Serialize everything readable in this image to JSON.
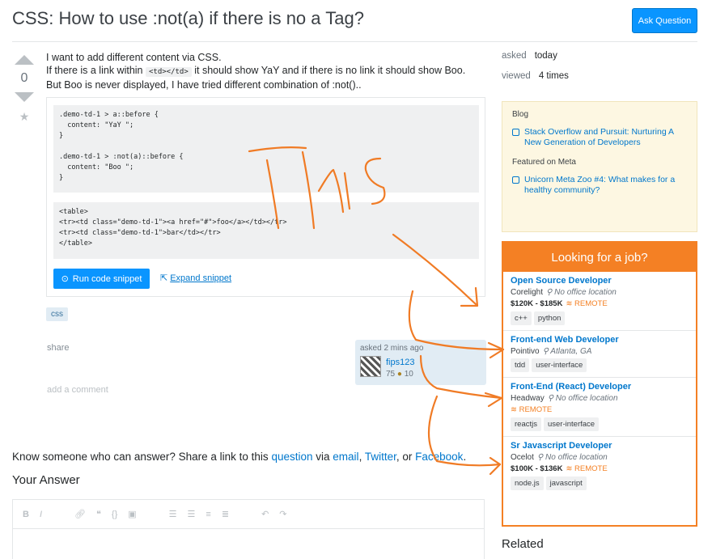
{
  "header": {
    "title": "CSS: How to use :not(a) if there is no a Tag?",
    "ask_button": "Ask Question"
  },
  "vote": {
    "count": "0"
  },
  "question": {
    "line1": "I want to add different content via CSS.",
    "line2_pre": "If there is a link within",
    "inline_code": "<td></td>",
    "line2_post": "it should show YaY and if there is no link it should show Boo. But Boo is never displayed, I have tried different combination of :not()..",
    "code_css": [
      ".demo-td-1 > a::before {",
      "  content: \"YaY \";",
      "}",
      "",
      ".demo-td-1 > :not(a)::before {",
      "  content: \"Boo \";",
      "}"
    ],
    "code_html": [
      "<table>",
      "<tr><td class=\"demo-td-1\"><a href=\"#\">foo</a></td></tr>",
      "<tr><td class=\"demo-td-1\">bar</td></tr>",
      "</table>"
    ],
    "run_button": "Run code snippet",
    "expand_link": "Expand snippet",
    "tag": "css",
    "share": "share",
    "asked_label": "asked 2 mins ago",
    "user_name": "fips123",
    "user_rep": "75",
    "user_bronze": "10",
    "add_comment": "add a comment"
  },
  "know": {
    "pre": "Know someone who can answer? Share a link to this",
    "question_link": "question",
    "via": "via",
    "email": "email",
    "twitter": "Twitter",
    "or": "or",
    "facebook": "Facebook"
  },
  "your_answer": "Your Answer",
  "meta": {
    "asked_label": "asked",
    "asked_value": "today",
    "viewed_label": "viewed",
    "viewed_value": "4 times"
  },
  "blog": {
    "head1": "Blog",
    "item1": "Stack Overflow and Pursuit: Nurturing A New Generation of Developers",
    "head2": "Featured on Meta",
    "item2": "Unicorn Meta Zoo #4: What makes for a healthy community?"
  },
  "jobs": {
    "title": "Looking for a job?",
    "items": [
      {
        "title": "Open Source Developer",
        "company": "Corelight",
        "location": "No office location",
        "salary": "$120K - $185K",
        "remote": "REMOTE",
        "tags": [
          "c++",
          "python"
        ]
      },
      {
        "title": "Front-end Web Developer",
        "company": "Pointivo",
        "location": "Atlanta, GA",
        "salary": "",
        "remote": "",
        "tags": [
          "tdd",
          "user-interface"
        ]
      },
      {
        "title": "Front-End (React) Developer",
        "company": "Headway",
        "location": "No office location",
        "salary": "",
        "remote": "REMOTE",
        "tags": [
          "reactjs",
          "user-interface"
        ]
      },
      {
        "title": "Sr Javascript Developer",
        "company": "Ocelot",
        "location": "No office location",
        "salary": "$100K - $136K",
        "remote": "REMOTE",
        "tags": [
          "node.js",
          "javascript"
        ]
      }
    ]
  },
  "related": "Related",
  "annotation": {
    "text": "This",
    "color": "#f07b25"
  }
}
